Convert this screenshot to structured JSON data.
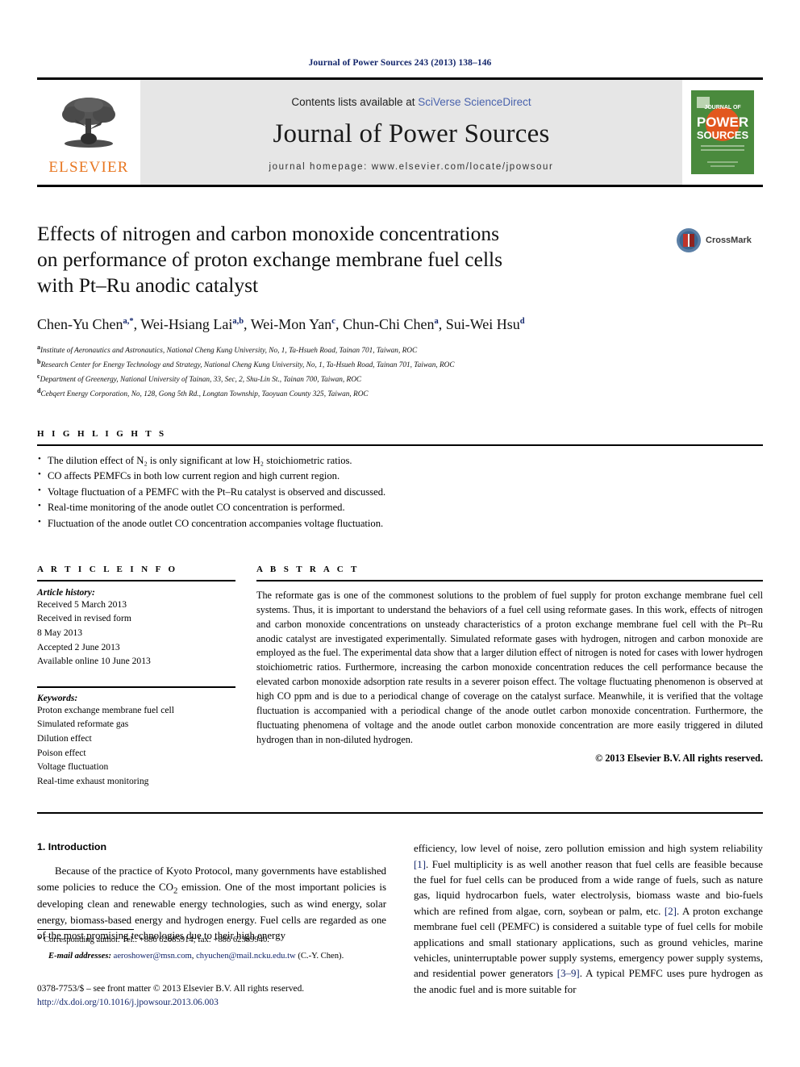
{
  "running_head": "Journal of Power Sources 243 (2013) 138–146",
  "masthead": {
    "publisher_name": "ELSEVIER",
    "contents_prefix": "Contents lists available at ",
    "contents_link": "SciVerse ScienceDirect",
    "journal_name": "Journal of Power Sources",
    "homepage": "journal homepage: www.elsevier.com/locate/jpowsour",
    "cover": {
      "line1": "JOURNAL OF",
      "line2": "POWER",
      "line3": "SOURCES"
    }
  },
  "article": {
    "title_line1": "Effects of nitrogen and carbon monoxide concentrations",
    "title_line2": "on performance of proton exchange membrane fuel cells",
    "title_line3": "with Pt–Ru anodic catalyst",
    "crossmark_label": "CrossMark",
    "authors": [
      {
        "name": "Chen-Yu Chen",
        "marks": "a,*"
      },
      {
        "name": "Wei-Hsiang Lai",
        "marks": "a,b"
      },
      {
        "name": "Wei-Mon Yan",
        "marks": "c"
      },
      {
        "name": "Chun-Chi Chen",
        "marks": "a"
      },
      {
        "name": "Sui-Wei Hsu",
        "marks": "d"
      }
    ],
    "affiliations": [
      {
        "mark": "a",
        "text": "Institute of Aeronautics and Astronautics, National Cheng Kung University, No, 1, Ta-Hsueh Road, Tainan 701, Taiwan, ROC"
      },
      {
        "mark": "b",
        "text": "Research Center for Energy Technology and Strategy, National Cheng Kung University, No, 1, Ta-Hsueh Road, Tainan 701, Taiwan, ROC"
      },
      {
        "mark": "c",
        "text": "Department of Greenergy, National University of Tainan, 33, Sec, 2, Shu-Lin St., Tainan 700, Taiwan, ROC"
      },
      {
        "mark": "d",
        "text": "Cebqert Energy Corporation, No, 128, Gong 5th Rd., Longtan Township, Taoyuan County 325, Taiwan, ROC"
      }
    ]
  },
  "highlights": {
    "heading": "H I G H L I G H T S",
    "items": [
      "The dilution effect of N₂ is only significant at low H₂ stoichiometric ratios.",
      "CO affects PEMFCs in both low current region and high current region.",
      "Voltage fluctuation of a PEMFC with the Pt–Ru catalyst is observed and discussed.",
      "Real-time monitoring of the anode outlet CO concentration is performed.",
      "Fluctuation of the anode outlet CO concentration accompanies voltage fluctuation."
    ]
  },
  "article_info": {
    "heading": "A R T I C L E  I N F O",
    "history_title": "Article history:",
    "history": [
      "Received 5 March 2013",
      "Received in revised form",
      "8 May 2013",
      "Accepted 2 June 2013",
      "Available online 10 June 2013"
    ],
    "keywords_title": "Keywords:",
    "keywords": [
      "Proton exchange membrane fuel cell",
      "Simulated reformate gas",
      "Dilution effect",
      "Poison effect",
      "Voltage fluctuation",
      "Real-time exhaust monitoring"
    ]
  },
  "abstract": {
    "heading": "A B S T R A C T",
    "text": "The reformate gas is one of the commonest solutions to the problem of fuel supply for proton exchange membrane fuel cell systems. Thus, it is important to understand the behaviors of a fuel cell using reformate gases. In this work, effects of nitrogen and carbon monoxide concentrations on unsteady characteristics of a proton exchange membrane fuel cell with the Pt–Ru anodic catalyst are investigated experimentally. Simulated reformate gases with hydrogen, nitrogen and carbon monoxide are employed as the fuel. The experimental data show that a larger dilution effect of nitrogen is noted for cases with lower hydrogen stoichiometric ratios. Furthermore, increasing the carbon monoxide concentration reduces the cell performance because the elevated carbon monoxide adsorption rate results in a severer poison effect. The voltage fluctuating phenomenon is observed at high CO ppm and is due to a periodical change of coverage on the catalyst surface. Meanwhile, it is verified that the voltage fluctuation is accompanied with a periodical change of the anode outlet carbon monoxide concentration. Furthermore, the fluctuating phenomena of voltage and the anode outlet carbon monoxide concentration are more easily triggered in diluted hydrogen than in non-diluted hydrogen.",
    "copyright": "© 2013 Elsevier B.V. All rights reserved."
  },
  "introduction": {
    "heading": "1.  Introduction",
    "left_paragraph_pre": "Because of the practice of Kyoto Protocol, many governments have established some policies to reduce the CO",
    "left_paragraph_sub": "2",
    "left_paragraph_post": " emission. One of the most important policies is developing clean and renewable energy technologies, such as wind energy, solar energy, biomass-based energy and hydrogen energy. Fuel cells are regarded as one of the most promising technologies due to their high energy",
    "right_part1": "efficiency, low level of noise, zero pollution emission and high system reliability ",
    "right_ref1": "[1]",
    "right_part2": ". Fuel multiplicity is as well another reason that fuel cells are feasible because the fuel for fuel cells can be produced from a wide range of fuels, such as nature gas, liquid hydrocarbon fuels, water electrolysis, biomass waste and bio-fuels which are refined from algae, corn, soybean or palm, etc. ",
    "right_ref2": "[2]",
    "right_part3": ". A proton exchange membrane fuel cell (PEMFC) is considered a suitable type of fuel cells for mobile applications and small stationary applications, such as ground vehicles, marine vehicles, uninterruptable power supply systems, emergency power supply systems, and residential power generators ",
    "right_ref3": "[3–9]",
    "right_part4": ". A typical PEMFC uses pure hydrogen as the anodic fuel and is more suitable for"
  },
  "footnotes": {
    "corresponding": "* Corresponding author. Tel.: +886 62085914; fax: +886 62389940.",
    "email_label": "E-mail addresses:",
    "email1": "aeroshower@msn.com",
    "email_sep": ", ",
    "email2": "chyuchen@mail.ncku.edu.tw",
    "email_suffix": " (C.-Y. Chen)."
  },
  "colophon": {
    "line1": "0378-7753/$ – see front matter © 2013 Elsevier B.V. All rights reserved.",
    "doi": "http://dx.doi.org/10.1016/j.jpowsour.2013.06.003"
  },
  "colors": {
    "elsevier_orange": "#E87722",
    "link_blue": "#13266b",
    "sciencedirect_blue": "#4a63ad",
    "cover_green": "#4a8a3d"
  }
}
